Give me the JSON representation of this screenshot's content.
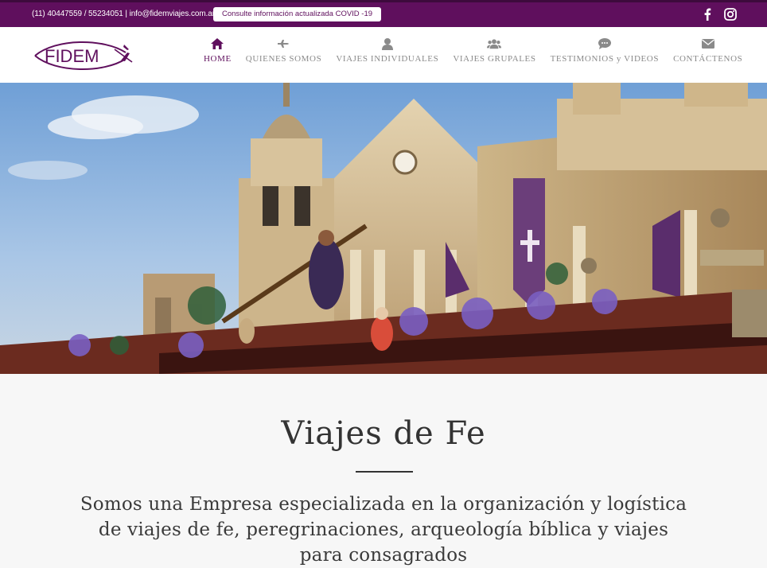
{
  "topbar": {
    "contact_text": "(11) 40447559 / 55234051 | info@fidemviajes.com.ar",
    "covid_button": "Consulte información actualizada COVID -19",
    "social": [
      {
        "icon": "facebook-icon"
      },
      {
        "icon": "instagram-icon"
      }
    ]
  },
  "logo": {
    "text": "FIDEM"
  },
  "nav": {
    "items": [
      {
        "label": "HOME",
        "icon": "home-icon",
        "active": true
      },
      {
        "label": "QUIENES SOMOS",
        "icon": "airplane-icon",
        "active": false
      },
      {
        "label": "VIAJES INDIVIDUALES",
        "icon": "user-icon",
        "active": false
      },
      {
        "label": "VIAJES GRUPALES",
        "icon": "users-icon",
        "active": false
      },
      {
        "label": "TESTIMONIOS y VIDEOS",
        "icon": "chat-icon",
        "active": false
      },
      {
        "label": "CONTÁCTENOS",
        "icon": "envelope-icon",
        "active": false
      }
    ]
  },
  "hero": {
    "image": "cathedral-procession-photo"
  },
  "main": {
    "title": "Viajes de Fe",
    "description": "Somos una Empresa especializada en la organización y logística de viajes de fe, peregrinaciones, arqueología bíblica y viajes para consagrados"
  },
  "colors": {
    "brand_purple": "#5f0f5d",
    "nav_gray": "#8a8a8a"
  }
}
